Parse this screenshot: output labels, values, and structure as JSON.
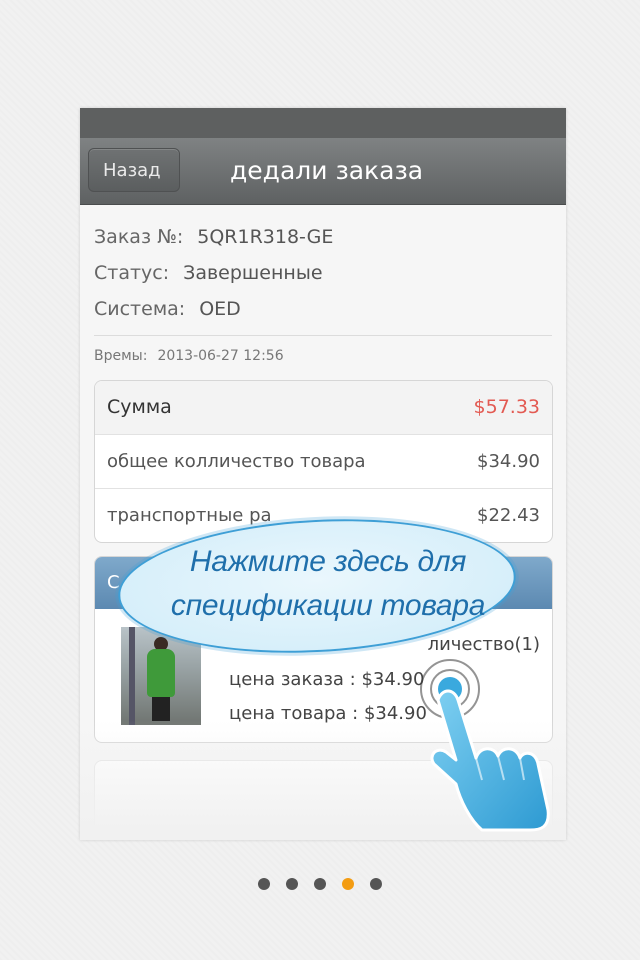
{
  "nav": {
    "back_label": "Назад",
    "title": "дедали заказа"
  },
  "order": {
    "number_label": "Заказ №:",
    "number_value": "5QR1R318-GE",
    "status_label": "Статус:",
    "status_value": "Завершенные",
    "system_label": "Система:",
    "system_value": "OED",
    "time_label": "Времы:",
    "time_value": "2013-06-27 12:56"
  },
  "summary": {
    "total_label": "Сумма",
    "total_value": "$57.33",
    "items_label": "общее колличество товара",
    "items_value": "$34.90",
    "shipping_label": "транспортные ра",
    "shipping_value": "$22.43"
  },
  "product": {
    "header_label": "С",
    "qty_text": "личество(1)",
    "order_price": "цена заказа : $34.90",
    "item_price": "цена товара : $34.90"
  },
  "tutorial": {
    "line1": "Нажмите здесь для",
    "line2": "спецификации товара"
  },
  "pager": {
    "count": 5,
    "active_index": 3
  },
  "colors": {
    "accent_price": "#e35a52",
    "hint_blue": "#3aa9de",
    "active_dot": "#f39c12"
  }
}
